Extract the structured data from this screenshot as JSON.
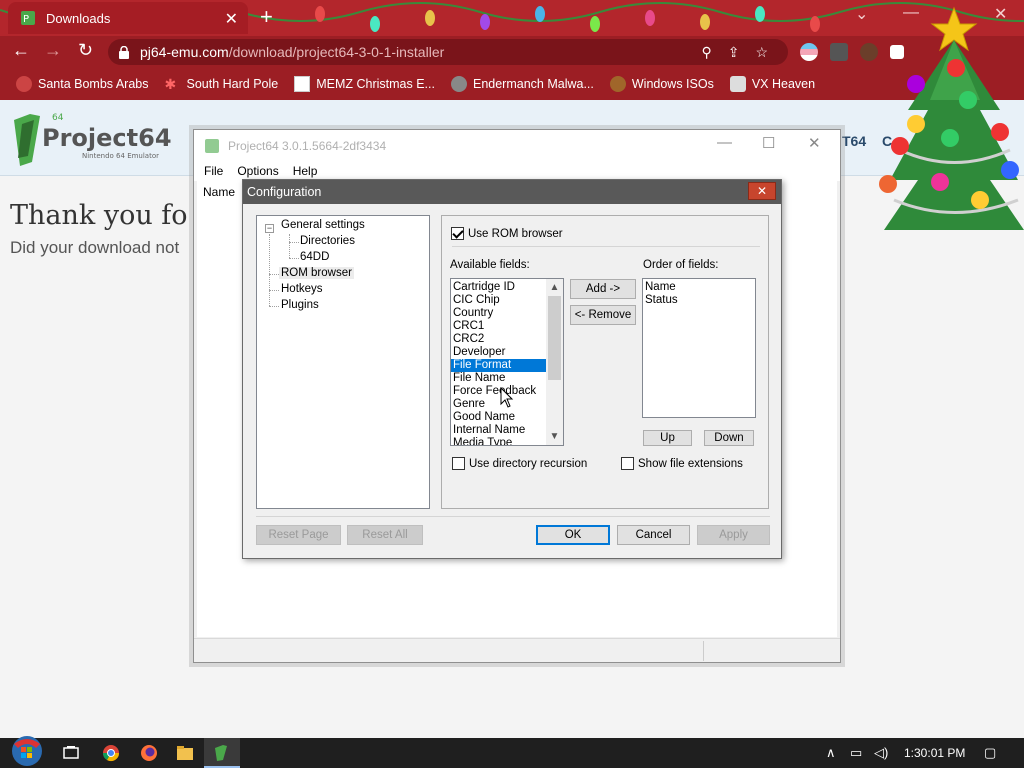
{
  "browser": {
    "tab_title": "Downloads",
    "tab_close": "✕",
    "new_tab": "+",
    "url_host": "pj64-emu.com",
    "url_path": "/download/project64-3-0-1-installer",
    "bookmarks": [
      {
        "label": "Santa Bombs Arabs",
        "icon": "santa-icon"
      },
      {
        "label": "South Hard Pole",
        "icon": "snowflake-icon"
      },
      {
        "label": "MEMZ Christmas E...",
        "icon": "memz-icon"
      },
      {
        "label": "Endermanch Malwa...",
        "icon": "raccoon-icon"
      },
      {
        "label": "Windows ISOs",
        "icon": "gingerbread-icon"
      },
      {
        "label": "VX Heaven",
        "icon": "shield-icon"
      }
    ],
    "window_controls": {
      "minimize": "⌄",
      "restore": "—",
      "maximize": "☐",
      "close": "✕"
    }
  },
  "page": {
    "nav_items": [
      "T64",
      "C"
    ],
    "title": "Thank you fo",
    "subtitle": "Did your download not"
  },
  "pj_window": {
    "title": "Project64 3.0.1.5664-2df3434",
    "menu": [
      "File",
      "Options",
      "Help"
    ],
    "column_header": "Name"
  },
  "dialog": {
    "title": "Configuration",
    "close": "✕",
    "tree": {
      "expander": "−",
      "general": "General settings",
      "directories": "Directories",
      "dd": "64DD",
      "rom_browser": "ROM browser",
      "hotkeys": "Hotkeys",
      "plugins": "Plugins"
    },
    "use_rom_browser": {
      "label": "Use ROM browser",
      "checked": true
    },
    "available_label": "Available fields:",
    "available_fields": [
      "Cartridge ID",
      "CIC Chip",
      "Country",
      "CRC1",
      "CRC2",
      "Developer",
      "File Format",
      "File Name",
      "Force Feedback",
      "Genre",
      "Good Name",
      "Internal Name",
      "Media Type"
    ],
    "selected_field": "File Format",
    "add_button": "Add ->",
    "remove_button": "<- Remove",
    "order_label": "Order of fields:",
    "order_fields": [
      "Name",
      "Status"
    ],
    "up_button": "Up",
    "down_button": "Down",
    "dir_recursion": {
      "label": "Use directory recursion",
      "checked": false
    },
    "show_ext": {
      "label": "Show file extensions",
      "checked": false
    },
    "reset_page": "Reset Page",
    "reset_all": "Reset All",
    "ok": "OK",
    "cancel": "Cancel",
    "apply": "Apply"
  },
  "taskbar": {
    "clock": "1:30:01 PM"
  },
  "colors": {
    "tab_bar": "#b3262c",
    "toolbar": "#9c1e24",
    "dialog_title": "#595959",
    "selection": "#0078d7",
    "taskbar": "#1f1f1f"
  }
}
